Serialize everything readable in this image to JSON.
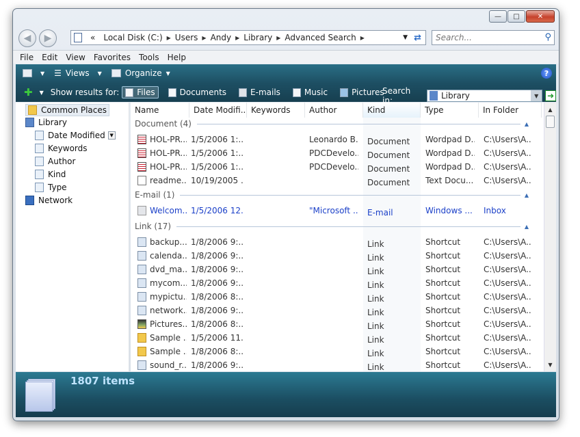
{
  "window": {
    "caption_buttons": [
      "minimize",
      "maximize",
      "close"
    ]
  },
  "address": {
    "overflow": "«",
    "segments": [
      "Local Disk (C:)",
      "Users",
      "Andy",
      "Library",
      "Advanced Search"
    ]
  },
  "search": {
    "placeholder": "Search..."
  },
  "menu": [
    "File",
    "Edit",
    "View",
    "Favorites",
    "Tools",
    "Help"
  ],
  "toolbar": {
    "views_label": "Views",
    "organize_label": "Organize"
  },
  "filters": {
    "show_results_label": "Show results for:",
    "items": [
      "Files",
      "Documents",
      "E-mails",
      "Music",
      "Pictures"
    ],
    "active": "Files",
    "search_in_label": "Search in:",
    "search_in_value": "Library"
  },
  "nav": {
    "items": [
      {
        "label": "Common Places",
        "icon": "folder-icon",
        "selected": true
      },
      {
        "label": "Library",
        "icon": "library-icon"
      },
      {
        "label": "Date Modified",
        "icon": "page-icon"
      },
      {
        "label": "Keywords",
        "icon": "page-icon"
      },
      {
        "label": "Author",
        "icon": "page-icon"
      },
      {
        "label": "Kind",
        "icon": "page-icon"
      },
      {
        "label": "Type",
        "icon": "page-icon"
      },
      {
        "label": "Network",
        "icon": "network-icon"
      }
    ]
  },
  "columns": [
    "Name",
    "Date Modifi...",
    "Keywords",
    "Author",
    "Kind",
    "Type",
    "In Folder"
  ],
  "sorted_column": "Kind",
  "groups": [
    {
      "title": "Document (4)",
      "rows": [
        {
          "icon": "wordpad-doc-icon",
          "name": "HOL-PR...",
          "date": "1/5/2006 1:...",
          "keywords": "",
          "author": "Leonardo B...",
          "kind": "Document",
          "type": "Wordpad D...",
          "folder": "C:\\Users\\A..."
        },
        {
          "icon": "wordpad-doc-icon",
          "name": "HOL-PR...",
          "date": "1/5/2006 1:...",
          "keywords": "",
          "author": "PDCDevelo...",
          "kind": "Document",
          "type": "Wordpad D...",
          "folder": "C:\\Users\\A..."
        },
        {
          "icon": "wordpad-doc-icon",
          "name": "HOL-PR...",
          "date": "1/5/2006 1:...",
          "keywords": "",
          "author": "PDCDevelo...",
          "kind": "Document",
          "type": "Wordpad D...",
          "folder": "C:\\Users\\A..."
        },
        {
          "icon": "text-doc-icon",
          "name": "readme....",
          "date": "10/19/2005 ...",
          "keywords": "",
          "author": "",
          "kind": "Document",
          "type": "Text Docu...",
          "folder": "C:\\Users\\A..."
        }
      ]
    },
    {
      "title": "E-mail (1)",
      "rows": [
        {
          "icon": "email-icon",
          "name": "Welcom...",
          "date": "1/5/2006 12...",
          "keywords": "",
          "author": "\"Microsoft ...",
          "kind": "E-mail",
          "type": "Windows ...",
          "folder": "Inbox",
          "highlight": true
        }
      ]
    },
    {
      "title": "Link (17)",
      "rows": [
        {
          "icon": "shortcut-icon",
          "name": "backup....",
          "date": "1/8/2006 9:...",
          "keywords": "",
          "author": "",
          "kind": "Link",
          "type": "Shortcut",
          "folder": "C:\\Users\\A..."
        },
        {
          "icon": "shortcut-icon",
          "name": "calenda...",
          "date": "1/8/2006 9:...",
          "keywords": "",
          "author": "",
          "kind": "Link",
          "type": "Shortcut",
          "folder": "C:\\Users\\A..."
        },
        {
          "icon": "dvd-shortcut-icon",
          "name": "dvd_ma...",
          "date": "1/8/2006 9:...",
          "keywords": "",
          "author": "",
          "kind": "Link",
          "type": "Shortcut",
          "folder": "C:\\Users\\A..."
        },
        {
          "icon": "shortcut-icon",
          "name": "mycom...",
          "date": "1/8/2006 9:...",
          "keywords": "",
          "author": "",
          "kind": "Link",
          "type": "Shortcut",
          "folder": "C:\\Users\\A..."
        },
        {
          "icon": "shortcut-icon",
          "name": "mypictu...",
          "date": "1/8/2006 8:...",
          "keywords": "",
          "author": "",
          "kind": "Link",
          "type": "Shortcut",
          "folder": "C:\\Users\\A..."
        },
        {
          "icon": "shortcut-icon",
          "name": "network...",
          "date": "1/8/2006 9:...",
          "keywords": "",
          "author": "",
          "kind": "Link",
          "type": "Shortcut",
          "folder": "C:\\Users\\A..."
        },
        {
          "icon": "pictures-shortcut-icon",
          "name": "Pictures...",
          "date": "1/8/2006 8:...",
          "keywords": "",
          "author": "",
          "kind": "Link",
          "type": "Shortcut",
          "folder": "C:\\Users\\A..."
        },
        {
          "icon": "folder-shortcut-icon",
          "name": "Sample ...",
          "date": "1/5/2006 11...",
          "keywords": "",
          "author": "",
          "kind": "Link",
          "type": "Shortcut",
          "folder": "C:\\Users\\A..."
        },
        {
          "icon": "folder-shortcut-icon",
          "name": "Sample ...",
          "date": "1/8/2006 8:...",
          "keywords": "",
          "author": "",
          "kind": "Link",
          "type": "Shortcut",
          "folder": "C:\\Users\\A..."
        },
        {
          "icon": "shortcut-icon",
          "name": "sound_r...",
          "date": "1/8/2006 9:...",
          "keywords": "",
          "author": "",
          "kind": "Link",
          "type": "Shortcut",
          "folder": "C:\\Users\\A..."
        }
      ]
    }
  ],
  "details": {
    "item_count": "1807 items"
  }
}
